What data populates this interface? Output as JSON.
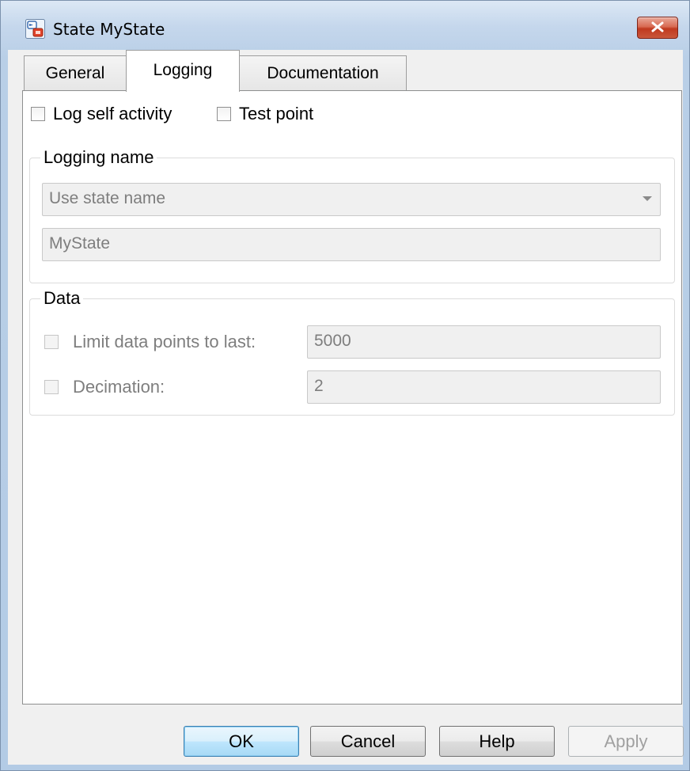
{
  "window": {
    "title": "State MyState",
    "icon": "stateflow-state-icon",
    "close_icon": "close-icon"
  },
  "tabs": [
    {
      "label": "General",
      "active": false
    },
    {
      "label": "Logging",
      "active": true
    },
    {
      "label": "Documentation",
      "active": false
    }
  ],
  "logging": {
    "log_self_activity": {
      "label": "Log self activity",
      "checked": false
    },
    "test_point": {
      "label": "Test point",
      "checked": false
    }
  },
  "logging_name": {
    "legend": "Logging name",
    "mode_select": {
      "value": "Use state name",
      "enabled": false
    },
    "name_field": {
      "value": "MyState",
      "enabled": false
    }
  },
  "data": {
    "legend": "Data",
    "limit_points": {
      "label": "Limit data points to last:",
      "checked": false,
      "value": "5000",
      "enabled": false
    },
    "decimation": {
      "label": "Decimation:",
      "checked": false,
      "value": "2",
      "enabled": false
    }
  },
  "buttons": {
    "ok": "OK",
    "cancel": "Cancel",
    "help": "Help",
    "apply": "Apply"
  },
  "colors": {
    "title_bar": "#c5d7ec",
    "close_button": "#c9573b",
    "default_button": "#bee6fd",
    "disabled_text": "#7e7e7e"
  }
}
